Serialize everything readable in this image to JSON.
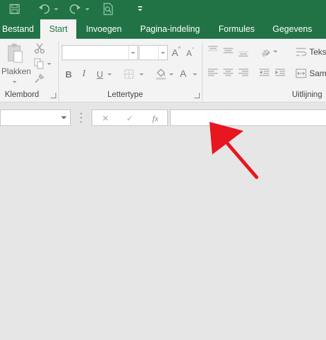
{
  "qat": {
    "icons": [
      "save-icon",
      "undo-icon",
      "redo-icon",
      "print-preview-icon",
      "customize-qat-icon"
    ]
  },
  "tabs": [
    {
      "label": "Bestand",
      "active": false
    },
    {
      "label": "Start",
      "active": true
    },
    {
      "label": "Invoegen",
      "active": false
    },
    {
      "label": "Pagina-indeling",
      "active": false
    },
    {
      "label": "Formules",
      "active": false
    },
    {
      "label": "Gegevens",
      "active": false
    }
  ],
  "ribbon": {
    "clipboard": {
      "paste_label": "Plakken",
      "group_label": "Klembord",
      "icons": [
        "paste-icon",
        "cut-icon",
        "copy-icon",
        "format-painter-icon"
      ]
    },
    "font": {
      "group_label": "Lettertype",
      "font_name_value": "",
      "font_size_value": "",
      "grow_label": "A",
      "shrink_label": "A",
      "bold_label": "B",
      "italic_label": "I",
      "underline_label": "U",
      "font_color_label": "A",
      "icons": [
        "borders-icon",
        "fill-color-icon"
      ]
    },
    "alignment": {
      "group_label": "Uitlijning",
      "wrap_text_label": "Teks",
      "merge_label": "Same",
      "icons": [
        "align-top-icon",
        "align-middle-icon",
        "align-bottom-icon",
        "orientation-icon",
        "align-left-icon",
        "align-center-icon",
        "align-right-icon",
        "decrease-indent-icon",
        "increase-indent-icon",
        "wrap-text-icon",
        "merge-center-icon"
      ]
    }
  },
  "formula_bar": {
    "name_box_value": "",
    "cancel_glyph": "✕",
    "enter_glyph": "✓",
    "fx_label": "fx",
    "formula_value": ""
  },
  "colors": {
    "brand": "#217346",
    "ribbon_bg": "#f3f3f3",
    "workspace_bg": "#e6e6e6",
    "annotation_arrow": "#e8161e"
  }
}
